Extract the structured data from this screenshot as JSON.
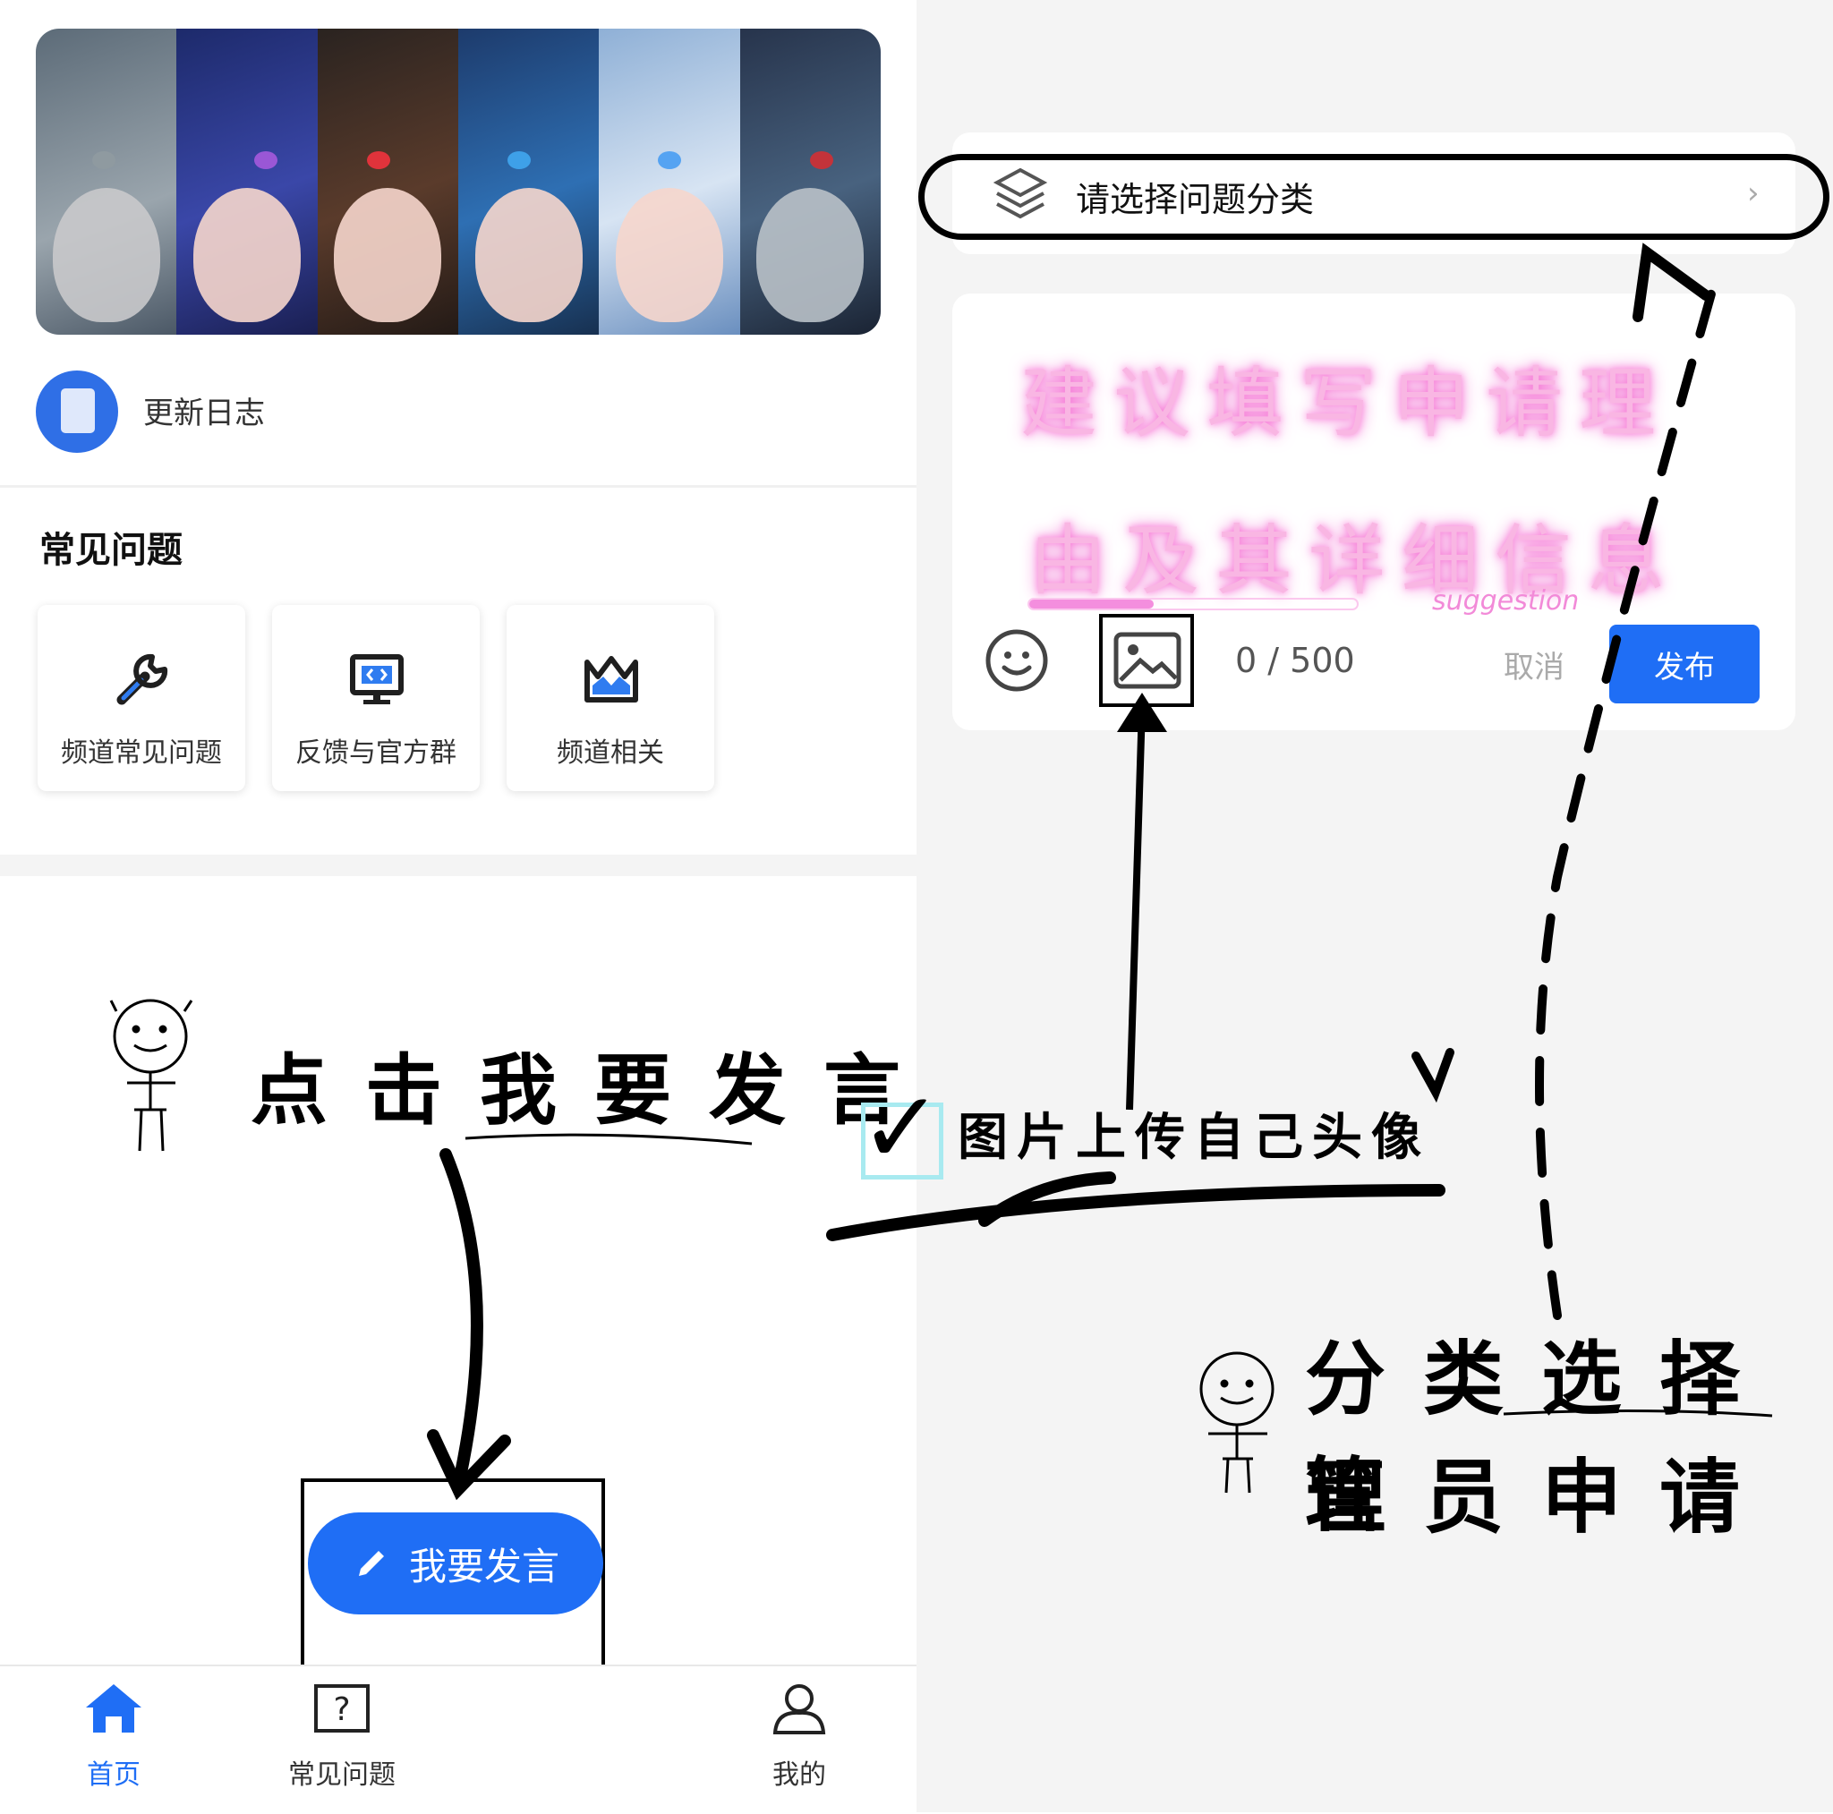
{
  "left_screen": {
    "changelog_label": "更新日志",
    "faq_section_title": "常见问题",
    "faq_cards": [
      {
        "label": "频道常见问题",
        "icon": "wrench-icon"
      },
      {
        "label": "反馈与官方群",
        "icon": "monitor-code-icon"
      },
      {
        "label": "频道相关",
        "icon": "crown-icon"
      }
    ],
    "fab_label": "我要发言",
    "tabs": [
      {
        "label": "首页",
        "icon": "home-icon",
        "active": true
      },
      {
        "label": "常见问题",
        "icon": "question-icon",
        "active": false
      },
      {
        "label": "我的",
        "icon": "user-icon",
        "active": false
      }
    ]
  },
  "right_screen": {
    "category_placeholder": "请选择问题分类",
    "hint_line1": "建议填写申请理",
    "hint_line2": "由及其详细信息",
    "hint_en": "suggestion",
    "counter": "0 / 500",
    "cancel_label": "取消",
    "publish_label": "发布"
  },
  "annotations": {
    "click_post": "点击我要发言",
    "upload_avatar": "图片上传自己头像",
    "category_line1": "分类选择管",
    "category_line2": "理员申请"
  },
  "colors": {
    "accent": "#1f6ef5",
    "hint_glow": "#f06bd0"
  }
}
